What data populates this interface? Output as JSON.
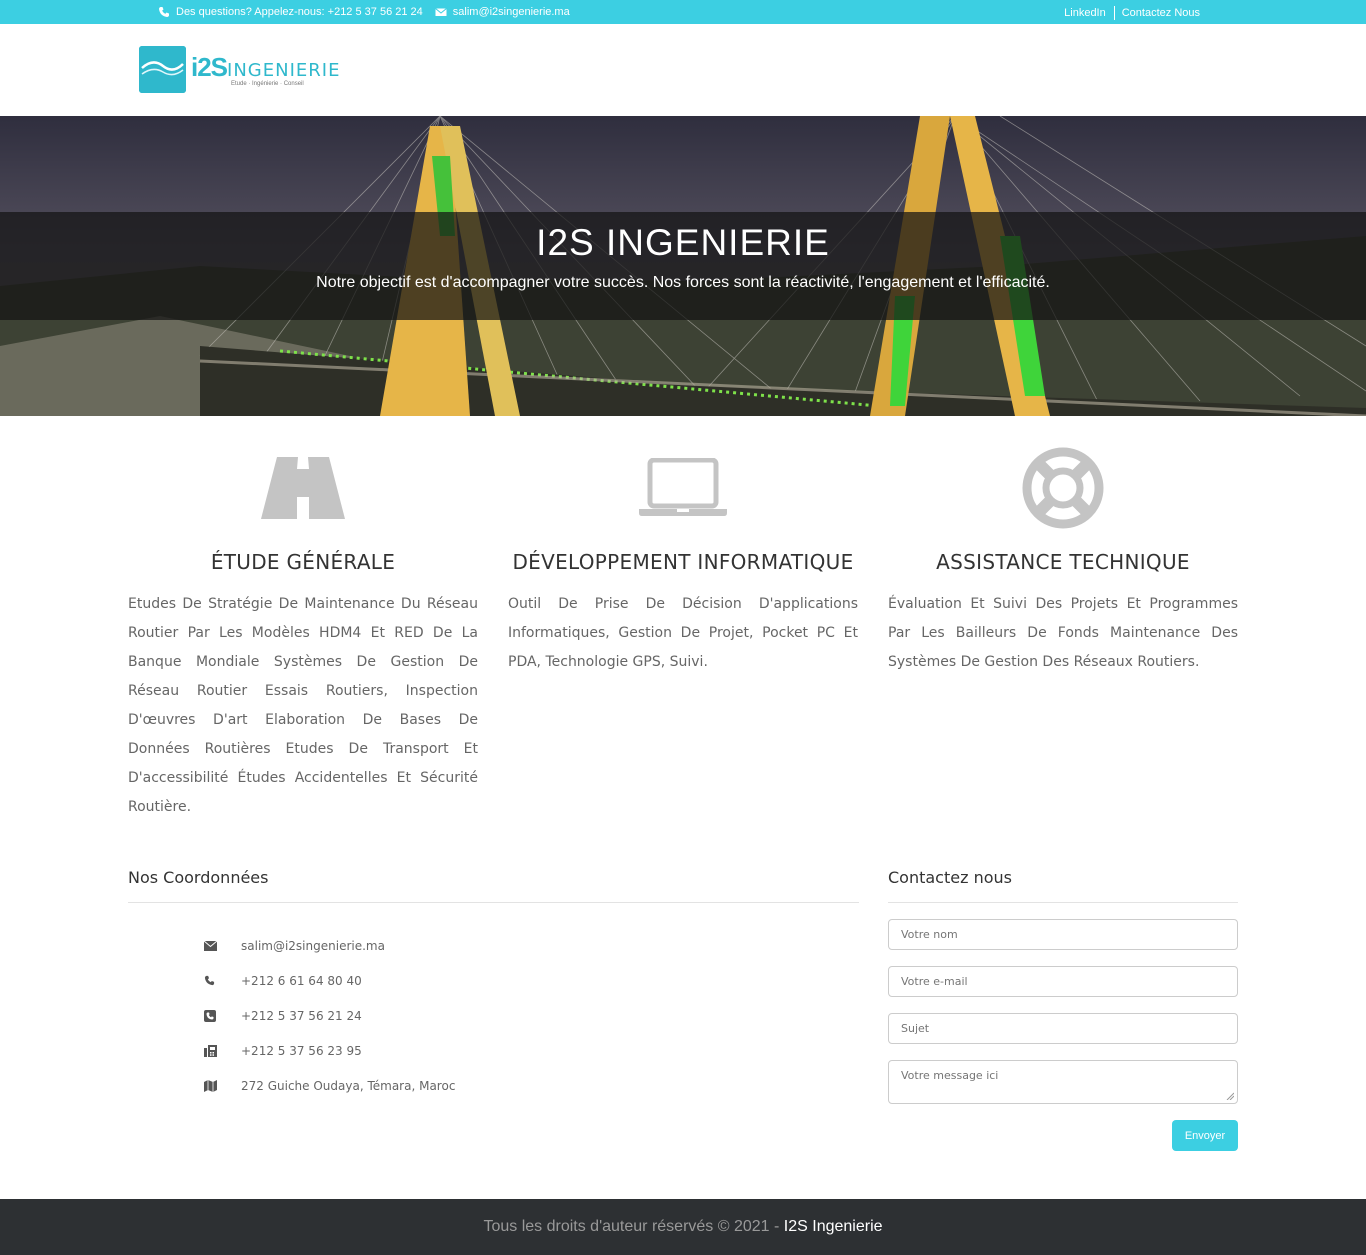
{
  "topbar": {
    "phone_text": "Des questions? Appelez-nous: +212 5 37 56 21 24",
    "email": "salim@i2singenierie.ma",
    "links": [
      "LinkedIn",
      "Contactez Nous"
    ]
  },
  "logo": {
    "brand": "i2S",
    "name": "INGENIERIE",
    "tagline": "Etude · Ingénierie · Conseil"
  },
  "hero": {
    "title": "I2S INGENIERIE",
    "subtitle": "Notre objectif est d'accompagner votre succès. Nos forces sont la réactivité, l'engagement et l'efficacité."
  },
  "services": [
    {
      "icon": "road-icon",
      "title": "ÉTUDE GÉNÉRALE",
      "text": "Etudes De Stratégie De Maintenance Du Réseau Routier Par Les Modèles HDM4 Et RED De La Banque Mondiale Systèmes De Gestion De Réseau Routier Essais Routiers, Inspection D'œuvres D'art Elaboration De Bases De Données Routières Etudes De Transport Et D'accessibilité Études Accidentelles Et Sécurité Routière."
    },
    {
      "icon": "laptop-icon",
      "title": "DÉVELOPPEMENT INFORMATIQUE",
      "text": "Outil De Prise De Décision D'applications Informatiques, Gestion De Projet, Pocket PC Et PDA, Technologie GPS, Suivi."
    },
    {
      "icon": "life-ring-icon",
      "title": "ASSISTANCE TECHNIQUE",
      "text": "Évaluation Et Suivi Des Projets Et Programmes Par Les Bailleurs De Fonds Maintenance Des Systèmes De Gestion Des Réseaux Routiers."
    }
  ],
  "coordinates": {
    "title": "Nos Coordonnées",
    "items": [
      {
        "icon": "envelope-icon",
        "text": "salim@i2singenierie.ma"
      },
      {
        "icon": "phone-icon",
        "text": "+212 6 61 64 80 40"
      },
      {
        "icon": "phone-square-icon",
        "text": "+212 5 37 56 21 24"
      },
      {
        "icon": "fax-icon",
        "text": "+212 5 37 56 23 95"
      },
      {
        "icon": "map-icon",
        "text": "272 Guiche Oudaya, Témara, Maroc"
      }
    ]
  },
  "contact_form": {
    "title": "Contactez nous",
    "name_placeholder": "Votre nom",
    "email_placeholder": "Votre e-mail",
    "subject_placeholder": "Sujet",
    "message_placeholder": "Votre message ici",
    "submit_label": "Envoyer"
  },
  "footer": {
    "copyright": "Tous les droits d'auteur réservés © 2021 - ",
    "brand": "I2S Ingenierie"
  },
  "colors": {
    "accent": "#3ccfe2",
    "logo": "#2fb8cc",
    "footer_bg": "#2d3033",
    "icon_gray": "#c4c4c4"
  }
}
